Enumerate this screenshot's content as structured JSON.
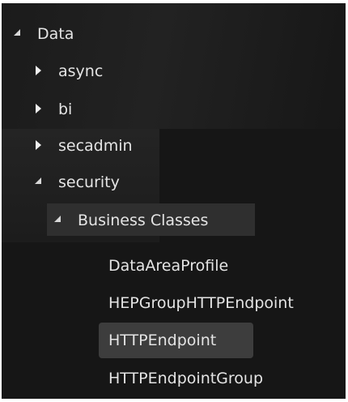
{
  "tree": {
    "root": {
      "label": "Data",
      "expanded": true
    },
    "children": [
      {
        "label": "async",
        "expanded": false
      },
      {
        "label": "bi",
        "expanded": false
      },
      {
        "label": "secadmin",
        "expanded": false
      },
      {
        "label": "security",
        "expanded": true
      }
    ],
    "business_classes": {
      "label": "Business Classes",
      "expanded": true
    },
    "classes": [
      {
        "label": "DataAreaProfile"
      },
      {
        "label": "HEPGroupHTTPEndpoint"
      },
      {
        "label": "HTTPEndpoint",
        "selected": true
      },
      {
        "label": "HTTPEndpointGroup"
      }
    ]
  }
}
